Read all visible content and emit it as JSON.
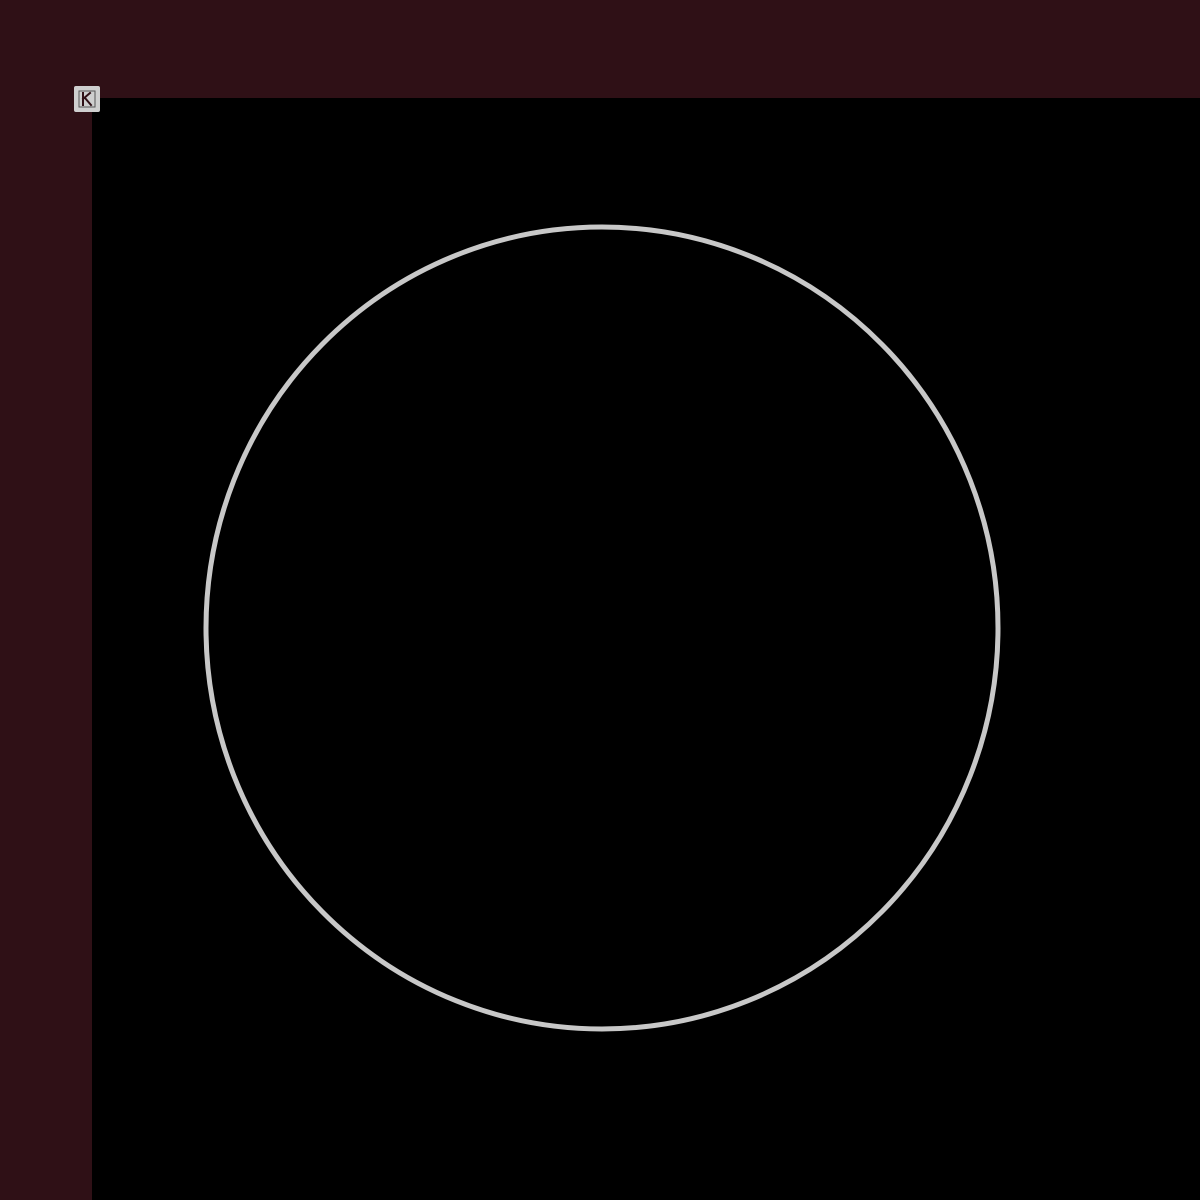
{
  "app": {
    "corner_icon": "k-logo-icon"
  },
  "colors": {
    "frame": "#2f1016",
    "canvas": "#000000",
    "circle_stroke": "#c8c8c8",
    "icon_bg": "#cfcfcf",
    "icon_fg": "#2f1016"
  },
  "canvas": {
    "shapes": [
      {
        "type": "circle-outline"
      }
    ]
  }
}
